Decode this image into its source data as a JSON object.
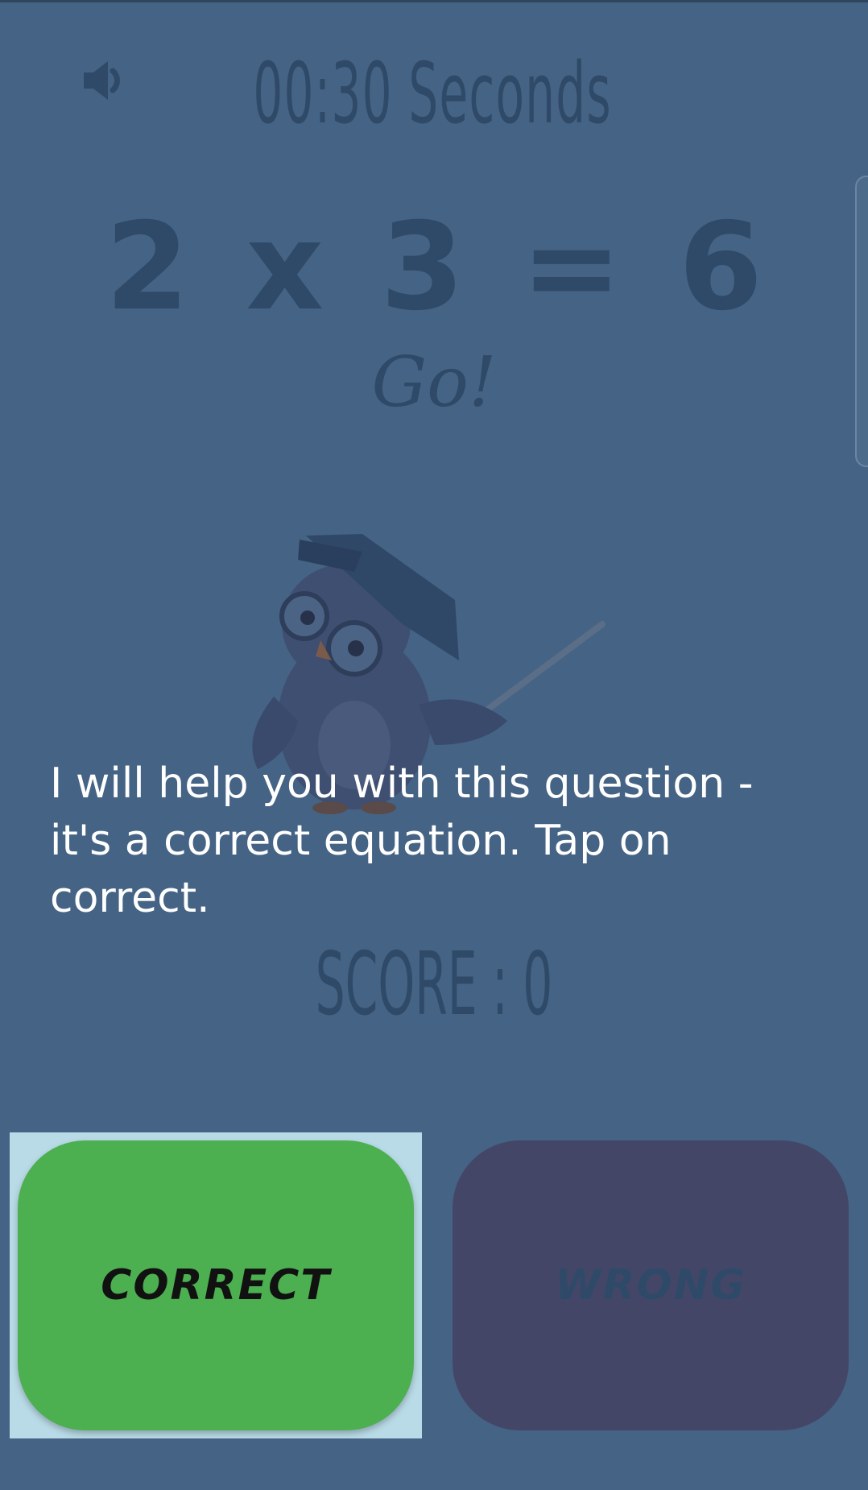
{
  "header": {
    "timer_text": "00:30 Seconds",
    "speaker_icon": "volume-icon"
  },
  "question": {
    "equation": "2 x 3 = 6",
    "status": "Go!"
  },
  "helper": {
    "mascot_icon": "owl-teacher-icon",
    "hint_text": "I will help you with this question - it's a correct equation. Tap on correct."
  },
  "score": {
    "text": "SCORE : 0"
  },
  "answers": {
    "correct_label": "CORRECT",
    "wrong_label": "WRONG"
  },
  "colors": {
    "background": "#456384",
    "correct": "#4caf50",
    "wrong": "#444668",
    "highlight": "#b9dbe7",
    "dim_text": "#2f4a68"
  }
}
